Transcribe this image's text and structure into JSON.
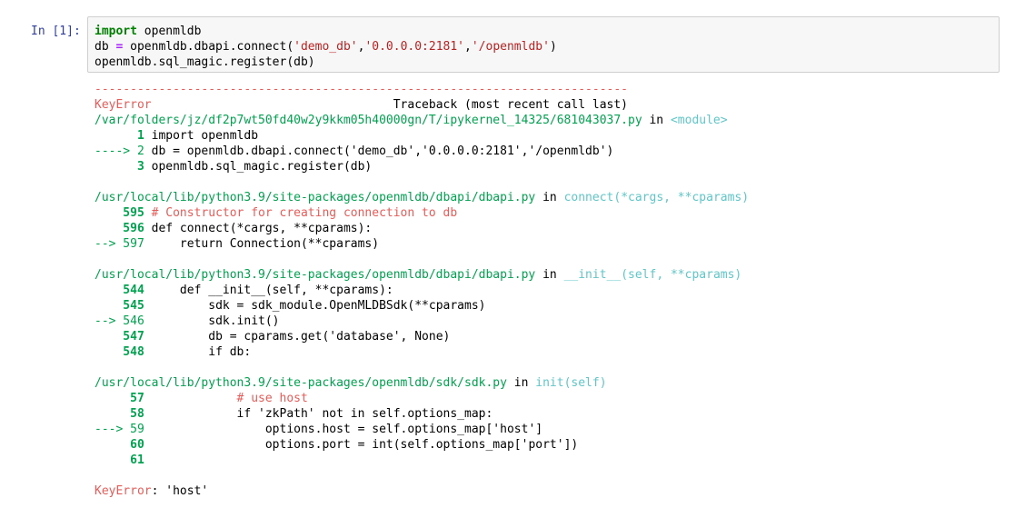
{
  "prompt": "In [1]:",
  "code": {
    "line1_kw": "import",
    "line1_rest": " openmldb",
    "line2_a": "db ",
    "line2_eq": "=",
    "line2_b": " openmldb.dbapi.connect(",
    "line2_s1": "'demo_db'",
    "line2_c1": ",",
    "line2_s2": "'0.0.0.0:2181'",
    "line2_c2": ",",
    "line2_s3": "'/openmldb'",
    "line2_end": ")",
    "line3": "openmldb.sql_magic.register(db)"
  },
  "traceback": {
    "dashes": "---------------------------------------------------------------------------",
    "error_name": "KeyError",
    "header_right": "                                  Traceback (most recent call last)",
    "frames": [
      {
        "path": "/var/folders/jz/df2p7wt50fd40w2y9kkm05h40000gn/T/ipykernel_14325/681043037.py",
        "in": " in ",
        "func": "<module>",
        "lines": [
          {
            "prefix": "      1 ",
            "code": "import openmldb"
          },
          {
            "prefix": "----> 2 ",
            "code": "db = openmldb.dbapi.connect('demo_db','0.0.0.0:2181','/openmldb')"
          },
          {
            "prefix": "      3 ",
            "code": "openmldb.sql_magic.register(db)"
          }
        ]
      },
      {
        "path": "/usr/local/lib/python3.9/site-packages/openmldb/dbapi/dbapi.py",
        "in": " in ",
        "func": "connect(*cargs, **cparams)",
        "lines": [
          {
            "prefix": "    595 ",
            "code": "# Constructor for creating connection to db"
          },
          {
            "prefix": "    596 ",
            "code": "def connect(*cargs, **cparams):"
          },
          {
            "prefix": "--> 597 ",
            "code": "    return Connection(**cparams)"
          }
        ]
      },
      {
        "path": "/usr/local/lib/python3.9/site-packages/openmldb/dbapi/dbapi.py",
        "in": " in ",
        "func": "__init__(self, **cparams)",
        "lines": [
          {
            "prefix": "    544 ",
            "code": "    def __init__(self, **cparams):"
          },
          {
            "prefix": "    545 ",
            "code": "        sdk = sdk_module.OpenMLDBSdk(**cparams)"
          },
          {
            "prefix": "--> 546 ",
            "code": "        sdk.init()"
          },
          {
            "prefix": "    547 ",
            "code": "        db = cparams.get('database', None)"
          },
          {
            "prefix": "    548 ",
            "code": "        if db:"
          }
        ]
      },
      {
        "path": "/usr/local/lib/python3.9/site-packages/openmldb/sdk/sdk.py",
        "in": " in ",
        "func": "init(self)",
        "lines": [
          {
            "prefix": "     57 ",
            "code": "            # use host"
          },
          {
            "prefix": "     58 ",
            "code": "            if 'zkPath' not in self.options_map:"
          },
          {
            "prefix": "---> 59 ",
            "code": "                options.host = self.options_map['host']"
          },
          {
            "prefix": "     60 ",
            "code": "                options.port = int(self.options_map['port'])"
          },
          {
            "prefix": "     61 ",
            "code": ""
          }
        ]
      }
    ],
    "final_error_name": "KeyError",
    "final_error_msg": ": 'host'"
  }
}
